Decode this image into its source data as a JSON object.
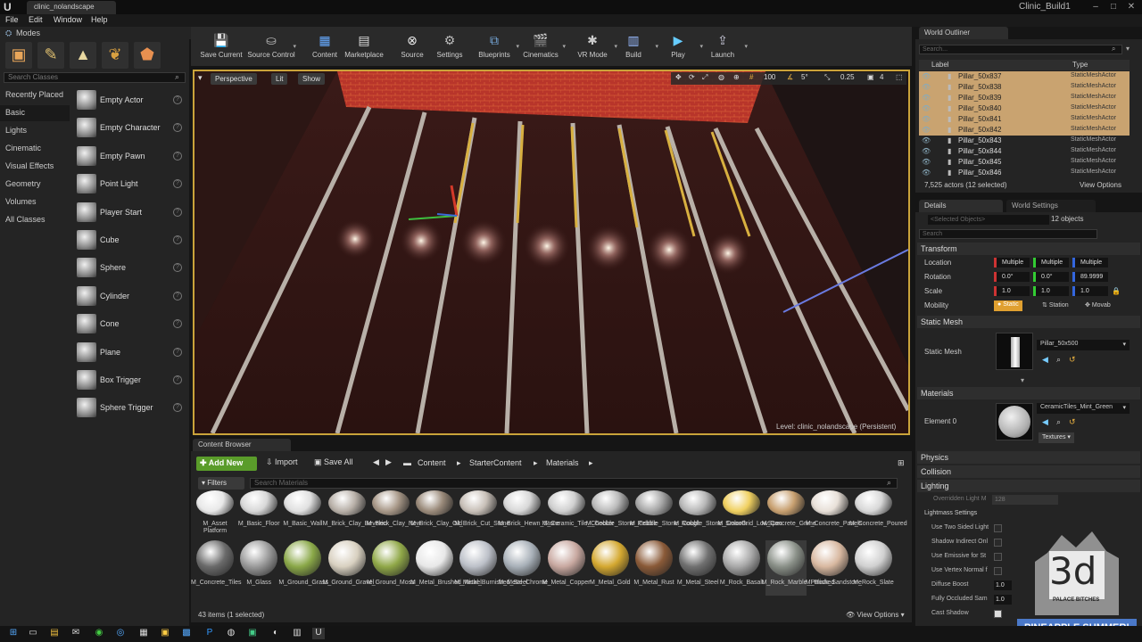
{
  "window": {
    "tab_title": "clinic_nolandscape",
    "project_name": "Clinic_Build1"
  },
  "menu": [
    "File",
    "Edit",
    "Window",
    "Help"
  ],
  "modes": {
    "label": "Modes",
    "search_placeholder": "Search Classes",
    "categories": [
      "Recently Placed",
      "Basic",
      "Lights",
      "Cinematic",
      "Visual Effects",
      "Geometry",
      "Volumes",
      "All Classes"
    ],
    "active_category": "Basic",
    "classes": [
      "Empty Actor",
      "Empty Character",
      "Empty Pawn",
      "Point Light",
      "Player Start",
      "Cube",
      "Sphere",
      "Cylinder",
      "Cone",
      "Plane",
      "Box Trigger",
      "Sphere Trigger"
    ]
  },
  "toolbar": [
    {
      "label": "Save Current",
      "icon": "save-icon"
    },
    {
      "label": "Source Control",
      "icon": "source-control-icon"
    },
    {
      "label": "Content",
      "icon": "content-icon"
    },
    {
      "label": "Marketplace",
      "icon": "marketplace-icon"
    },
    {
      "label": "Source",
      "icon": "source-icon"
    },
    {
      "label": "Settings",
      "icon": "settings-icon"
    },
    {
      "label": "Blueprints",
      "icon": "blueprints-icon"
    },
    {
      "label": "Cinematics",
      "icon": "cinematics-icon"
    },
    {
      "label": "VR Mode",
      "icon": "vr-icon"
    },
    {
      "label": "Build",
      "icon": "build-icon"
    },
    {
      "label": "Play",
      "icon": "play-icon"
    },
    {
      "label": "Launch",
      "icon": "launch-icon"
    }
  ],
  "viewport": {
    "perspective": "Perspective",
    "lit": "Lit",
    "show": "Show",
    "grid_snap": "100",
    "rot_snap": "5°",
    "scale_snap": "0.25",
    "camera_speed": "4",
    "level_label": "Level:",
    "level_name": "clinic_nolandscape (Persistent)"
  },
  "content_browser": {
    "tab": "Content Browser",
    "add_new": "Add New",
    "import": "Import",
    "save_all": "Save All",
    "breadcrumb": [
      "Content",
      "StarterContent",
      "Materials"
    ],
    "filters": "Filters",
    "search_placeholder": "Search Materials",
    "status": "43 items (1 selected)",
    "view_options": "View Options",
    "assets_row1": [
      "M_Asset Platform",
      "M_Basic_Floor",
      "M_Basic_Wall",
      "M_Brick_Clay_Beveled",
      "M_Brick_Clay_New",
      "M_Brick_Clay_Old",
      "M_Brick_Cut_Stone",
      "M_Brick_Hewn_Stone",
      "M_Ceramic_Tile_Checker",
      "M_Cobble_Stone_Pebble",
      "M_Cobble_Stone_Rough",
      "M_Cobble_Stone_Smooth",
      "M_ColorGrid_LowSpec",
      "M_Concrete_Grime",
      "M_Concrete_Panels",
      "M_Concrete_Poured"
    ],
    "assets_row2": [
      "M_Concrete_Tiles",
      "M_Glass",
      "M_Ground_Grass",
      "M_Ground_Gravel",
      "M_Ground_Moss",
      "M_Metal_Brushed_Nickel",
      "M_Metal_Burnished_Steel",
      "M_Metal_Chrome",
      "M_Metal_Copper",
      "M_Metal_Gold",
      "M_Metal_Rust",
      "M_Metal_Steel",
      "M_Rock_Basalt",
      "M_Rock_Marble_Polished",
      "M_Rock_Sandstone",
      "M_Rock_Slate"
    ]
  },
  "outliner": {
    "tab": "World Outliner",
    "search_placeholder": "Search...",
    "col_label": "Label",
    "col_type": "Type",
    "rows": [
      {
        "name": "Pillar_50x837",
        "type": "StaticMeshActor",
        "selected": true
      },
      {
        "name": "Pillar_50x838",
        "type": "StaticMeshActor",
        "selected": true
      },
      {
        "name": "Pillar_50x839",
        "type": "StaticMeshActor",
        "selected": true
      },
      {
        "name": "Pillar_50x840",
        "type": "StaticMeshActor",
        "selected": true
      },
      {
        "name": "Pillar_50x841",
        "type": "StaticMeshActor",
        "selected": true
      },
      {
        "name": "Pillar_50x842",
        "type": "StaticMeshActor",
        "selected": true
      },
      {
        "name": "Pillar_50x843",
        "type": "StaticMeshActor",
        "selected": false
      },
      {
        "name": "Pillar_50x844",
        "type": "StaticMeshActor",
        "selected": false
      },
      {
        "name": "Pillar_50x845",
        "type": "StaticMeshActor",
        "selected": false
      },
      {
        "name": "Pillar_50x846",
        "type": "StaticMeshActor",
        "selected": false
      }
    ],
    "count": "7,525 actors (12 selected)",
    "view_options": "View Options"
  },
  "details": {
    "tab": "Details",
    "ws_tab": "World Settings",
    "selected_objects": "<Selected Objects>",
    "objects_count": "12 objects",
    "search_placeholder": "Search",
    "transform": "Transform",
    "location": "Location",
    "rotation": "Rotation",
    "scale": "Scale",
    "mobility": "Mobility",
    "loc": [
      "Multiple",
      "Multiple",
      "Multiple"
    ],
    "rot": [
      "0.0°",
      "0.0°",
      "89.9999"
    ],
    "scl": [
      "1.0",
      "1.0",
      "1.0"
    ],
    "mobility_opts": [
      "Static",
      "Station",
      "Movab"
    ],
    "static_mesh_section": "Static Mesh",
    "static_mesh_label": "Static Mesh",
    "static_mesh_value": "Pillar_50x500",
    "materials_section": "Materials",
    "element0": "Element 0",
    "material_value": "CeramicTiles_Mint_Green",
    "textures": "Textures",
    "physics": "Physics",
    "collision": "Collision",
    "lighting": "Lighting",
    "override_light": "Overridden Light M",
    "override_value": "128",
    "lightmass": "Lightmass Settings",
    "light_rows": [
      "Use Two Sided Light",
      "Shadow Indirect Onl",
      "Use Emissive for St",
      "Use Vertex Normal f",
      "Diffuse Boost",
      "Fully Occluded Sam",
      "Cast Shadow"
    ],
    "diffuse_boost": "1.0",
    "fully_occluded": "1.0"
  },
  "watermark": {
    "logo_text": "3d",
    "subtitle": "PALACE BITCHES",
    "banner": "PINEAPPLE SUMMER!"
  },
  "colors": {
    "selection": "#caa33a",
    "add_new": "#5a9c2a",
    "outliner_sel": "#c9a370"
  }
}
